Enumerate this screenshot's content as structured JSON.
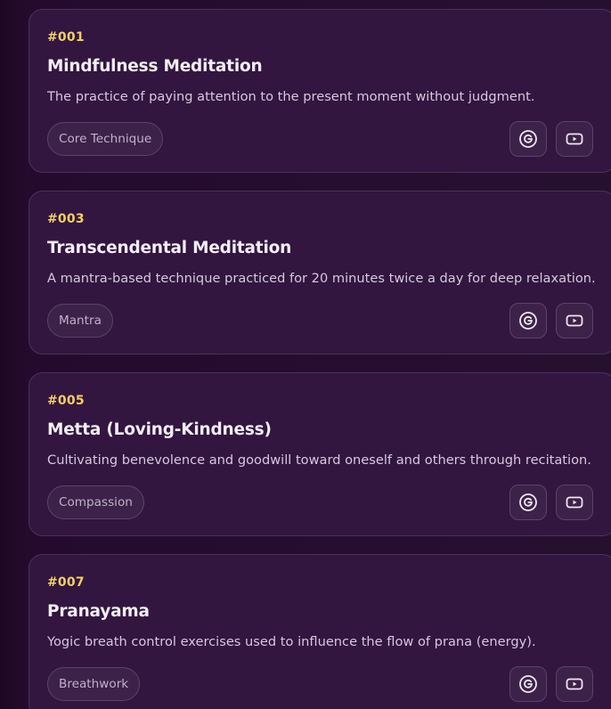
{
  "cards": [
    {
      "id": "#001",
      "title": "Mindfulness Meditation",
      "description": "The practice of paying attention to the present moment without judgment.",
      "tag": "Core Technique"
    },
    {
      "id": "#003",
      "title": "Transcendental Meditation",
      "description": "A mantra-based technique practiced for 20 minutes twice a day for deep relaxation.",
      "tag": "Mantra"
    },
    {
      "id": "#005",
      "title": "Metta (Loving-Kindness)",
      "description": "Cultivating benevolence and goodwill toward oneself and others through recitation.",
      "tag": "Compassion"
    },
    {
      "id": "#007",
      "title": "Pranayama",
      "description": "Yogic breath control exercises used to influence the flow of prana (energy).",
      "tag": "Breathwork"
    }
  ],
  "icons": {
    "search": "google-icon",
    "video": "video-play-icon"
  },
  "colors": {
    "id_accent": "#f4cf63",
    "card_bg": "#32163f",
    "page_bg": "#220a2b"
  }
}
